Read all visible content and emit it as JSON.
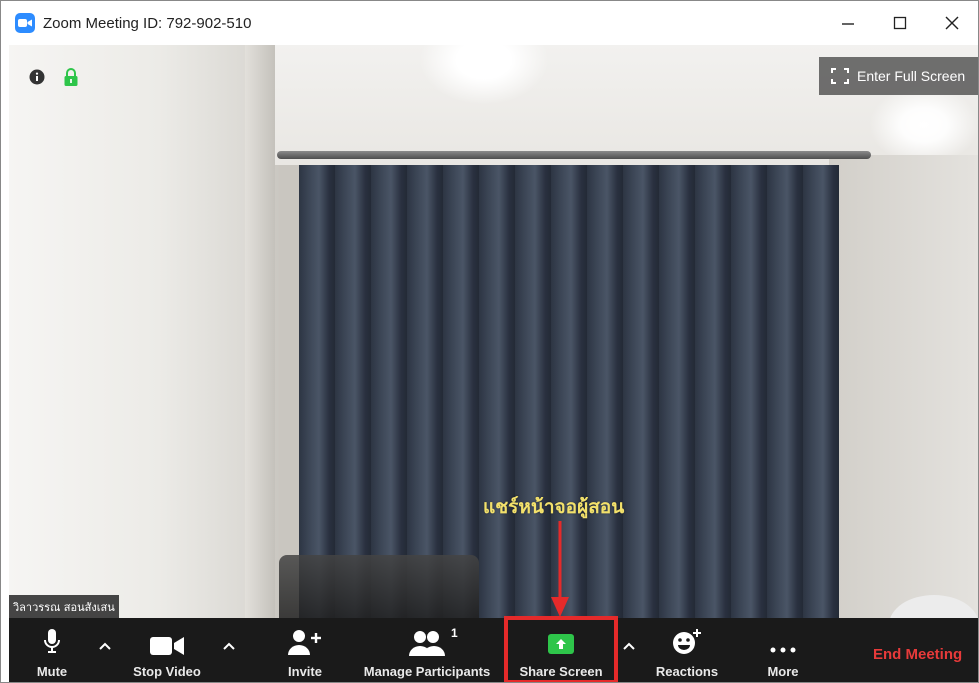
{
  "window": {
    "title": "Zoom Meeting ID: 792-902-510"
  },
  "video": {
    "fullscreen_label": "Enter Full Screen",
    "participant_name": "วิลาวรรณ สอนสังเสน",
    "annotation_text": "แชร์หน้าจอผู้สอน",
    "annotation_color": "#f3e16b",
    "arrow_color": "#e52a2a"
  },
  "toolbar": {
    "mute_label": "Mute",
    "stop_video_label": "Stop Video",
    "invite_label": "Invite",
    "participants_label": "Manage Participants",
    "participants_count": "1",
    "share_label": "Share Screen",
    "reactions_label": "Reactions",
    "more_label": "More",
    "end_label": "End Meeting",
    "share_color": "#2ec54a",
    "end_color": "#e83a3a",
    "highlight_color": "#e52a2a"
  }
}
